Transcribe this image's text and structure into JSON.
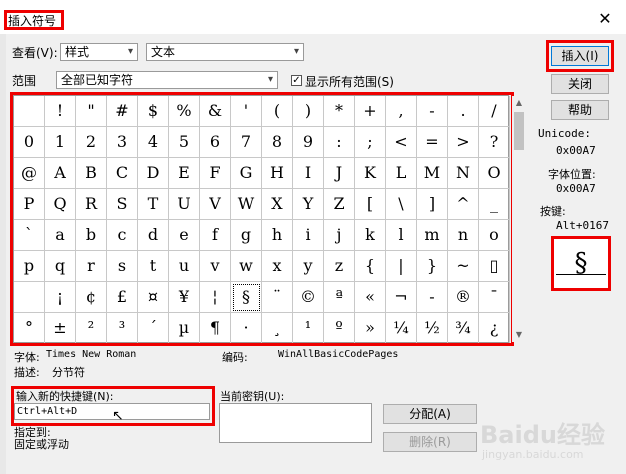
{
  "title": "插入符号",
  "close_glyph": "✕",
  "view": {
    "label": "查看(V):",
    "value": "样式",
    "text_value": "文本"
  },
  "range": {
    "label": "范围",
    "value": "全部已知字符",
    "show_all_label": "显示所有范围(S)",
    "show_all_checked": true
  },
  "buttons": {
    "insert": "插入(I)",
    "close": "关闭",
    "help": "帮助",
    "assign": "分配(A)",
    "delete": "删除(R)"
  },
  "unicode": {
    "label": "Unicode:",
    "value": "0x00A7"
  },
  "font_pos": {
    "label": "字体位置:",
    "value": "0x00A7"
  },
  "keystroke": {
    "label": "按键:",
    "value": "Alt+0167"
  },
  "preview_char": "§",
  "grid_rows": [
    [
      "",
      "!",
      "\"",
      "#",
      "$",
      "%",
      "&",
      "'",
      "(",
      ")",
      "*",
      "+",
      ",",
      "-",
      ".",
      "/"
    ],
    [
      "0",
      "1",
      "2",
      "3",
      "4",
      "5",
      "6",
      "7",
      "8",
      "9",
      ":",
      ";",
      "<",
      "=",
      ">",
      "?"
    ],
    [
      "@",
      "A",
      "B",
      "C",
      "D",
      "E",
      "F",
      "G",
      "H",
      "I",
      "J",
      "K",
      "L",
      "M",
      "N",
      "O"
    ],
    [
      "P",
      "Q",
      "R",
      "S",
      "T",
      "U",
      "V",
      "W",
      "X",
      "Y",
      "Z",
      "[",
      "\\",
      "]",
      "^",
      "_"
    ],
    [
      "`",
      "a",
      "b",
      "c",
      "d",
      "e",
      "f",
      "g",
      "h",
      "i",
      "j",
      "k",
      "l",
      "m",
      "n",
      "o"
    ],
    [
      "p",
      "q",
      "r",
      "s",
      "t",
      "u",
      "v",
      "w",
      "x",
      "y",
      "z",
      "{",
      "|",
      "}",
      "~",
      "▯"
    ],
    [
      "",
      "¡",
      "¢",
      "£",
      "¤",
      "¥",
      "¦",
      "§",
      "¨",
      "©",
      "ª",
      "«",
      "¬",
      "-",
      "®",
      "¯"
    ],
    [
      "°",
      "±",
      "²",
      "³",
      "´",
      "µ",
      "¶",
      "·",
      "¸",
      "¹",
      "º",
      "»",
      "¼",
      "½",
      "¾",
      "¿"
    ]
  ],
  "selected_cell": {
    "row": 6,
    "col": 7
  },
  "font_line": {
    "label": "字体:",
    "value": "Times New Roman"
  },
  "encoding": {
    "label": "编码:",
    "value": "WinAllBasicCodePages"
  },
  "description": {
    "label": "描述:",
    "value": "分节符"
  },
  "new_shortcut": {
    "label": "输入新的快捷键(N):",
    "value": "Ctrl+Alt+D"
  },
  "current_keys": {
    "label": "当前密钥(U):"
  },
  "specify": {
    "label": "指定到:",
    "value": "固定或浮动"
  },
  "watermark": {
    "brand": "Baidu经验",
    "url": "jingyan.baidu.com"
  }
}
